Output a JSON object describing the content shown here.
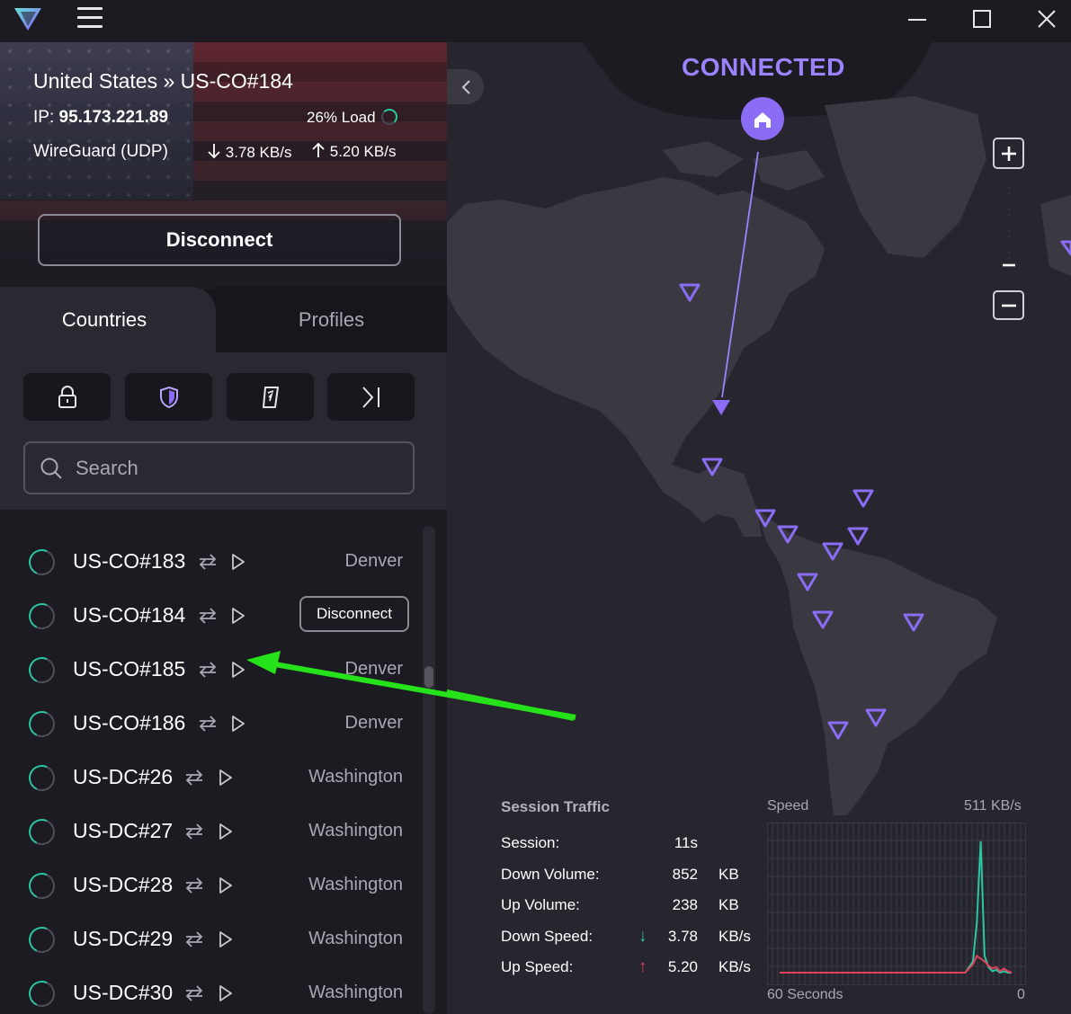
{
  "window": {
    "minimize_icon": "minimize-icon",
    "maximize_icon": "maximize-icon",
    "close_icon": "close-icon"
  },
  "connection": {
    "title": "United States » US-CO#184",
    "ip_label": "IP:",
    "ip": "95.173.221.89",
    "load": "26% Load",
    "load_percent": 26,
    "protocol": "WireGuard (UDP)",
    "down_rate": "3.78 KB/s",
    "up_rate": "5.20 KB/s",
    "disconnect_label": "Disconnect"
  },
  "tabs": [
    {
      "label": "Countries",
      "active": true
    },
    {
      "label": "Profiles",
      "active": false
    }
  ],
  "filters": [
    {
      "icon": "lock-icon"
    },
    {
      "icon": "shield-icon"
    },
    {
      "icon": "p2p-icon"
    },
    {
      "icon": "tor-icon"
    }
  ],
  "search": {
    "placeholder": "Search"
  },
  "servers": [
    {
      "name": "US-CO#183",
      "city": "Denver"
    },
    {
      "name": "US-CO#184",
      "city": "",
      "action": "Disconnect"
    },
    {
      "name": "US-CO#185",
      "city": "Denver"
    },
    {
      "name": "US-CO#186",
      "city": "Denver"
    },
    {
      "name": "US-DC#26",
      "city": "Washington"
    },
    {
      "name": "US-DC#27",
      "city": "Washington"
    },
    {
      "name": "US-DC#28",
      "city": "Washington"
    },
    {
      "name": "US-DC#29",
      "city": "Washington"
    },
    {
      "name": "US-DC#30",
      "city": "Washington"
    }
  ],
  "map": {
    "status": "CONNECTED",
    "accent": "#9d82ff",
    "zoom_in": "+",
    "zoom_out": "−"
  },
  "session": {
    "title": "Session Traffic",
    "rows": [
      {
        "label": "Session:",
        "value": "11s",
        "unit": ""
      },
      {
        "label": "Down Volume:",
        "value": "852",
        "unit": "KB"
      },
      {
        "label": "Up Volume:",
        "value": "238",
        "unit": "KB"
      },
      {
        "label": "Down Speed:",
        "value": "3.78",
        "unit": "KB/s",
        "arrow": "↓",
        "arrow_color": "#2bc7a3"
      },
      {
        "label": "Up Speed:",
        "value": "5.20",
        "unit": "KB/s",
        "arrow": "↑",
        "arrow_color": "#e0405a"
      }
    ]
  },
  "speed_chart": {
    "label": "Speed",
    "max": "511  KB/s",
    "window": "60 Seconds",
    "zero": "0"
  },
  "chart_data": {
    "type": "line",
    "title": "",
    "xlabel": "60 Seconds",
    "ylabel": "Speed",
    "ylim": [
      0,
      511
    ],
    "x": [
      0,
      42,
      48,
      50,
      51,
      52,
      53,
      54,
      55,
      56,
      57,
      58,
      59,
      60
    ],
    "series": [
      {
        "name": "",
        "color": "#2bc7a3",
        "values": [
          0,
          0,
          0,
          40,
          180,
          470,
          60,
          20,
          5,
          10,
          0,
          5,
          0,
          0
        ]
      },
      {
        "name": "",
        "color": "#e0405a",
        "values": [
          0,
          0,
          0,
          30,
          60,
          50,
          40,
          25,
          15,
          20,
          5,
          15,
          5,
          0
        ]
      }
    ]
  }
}
